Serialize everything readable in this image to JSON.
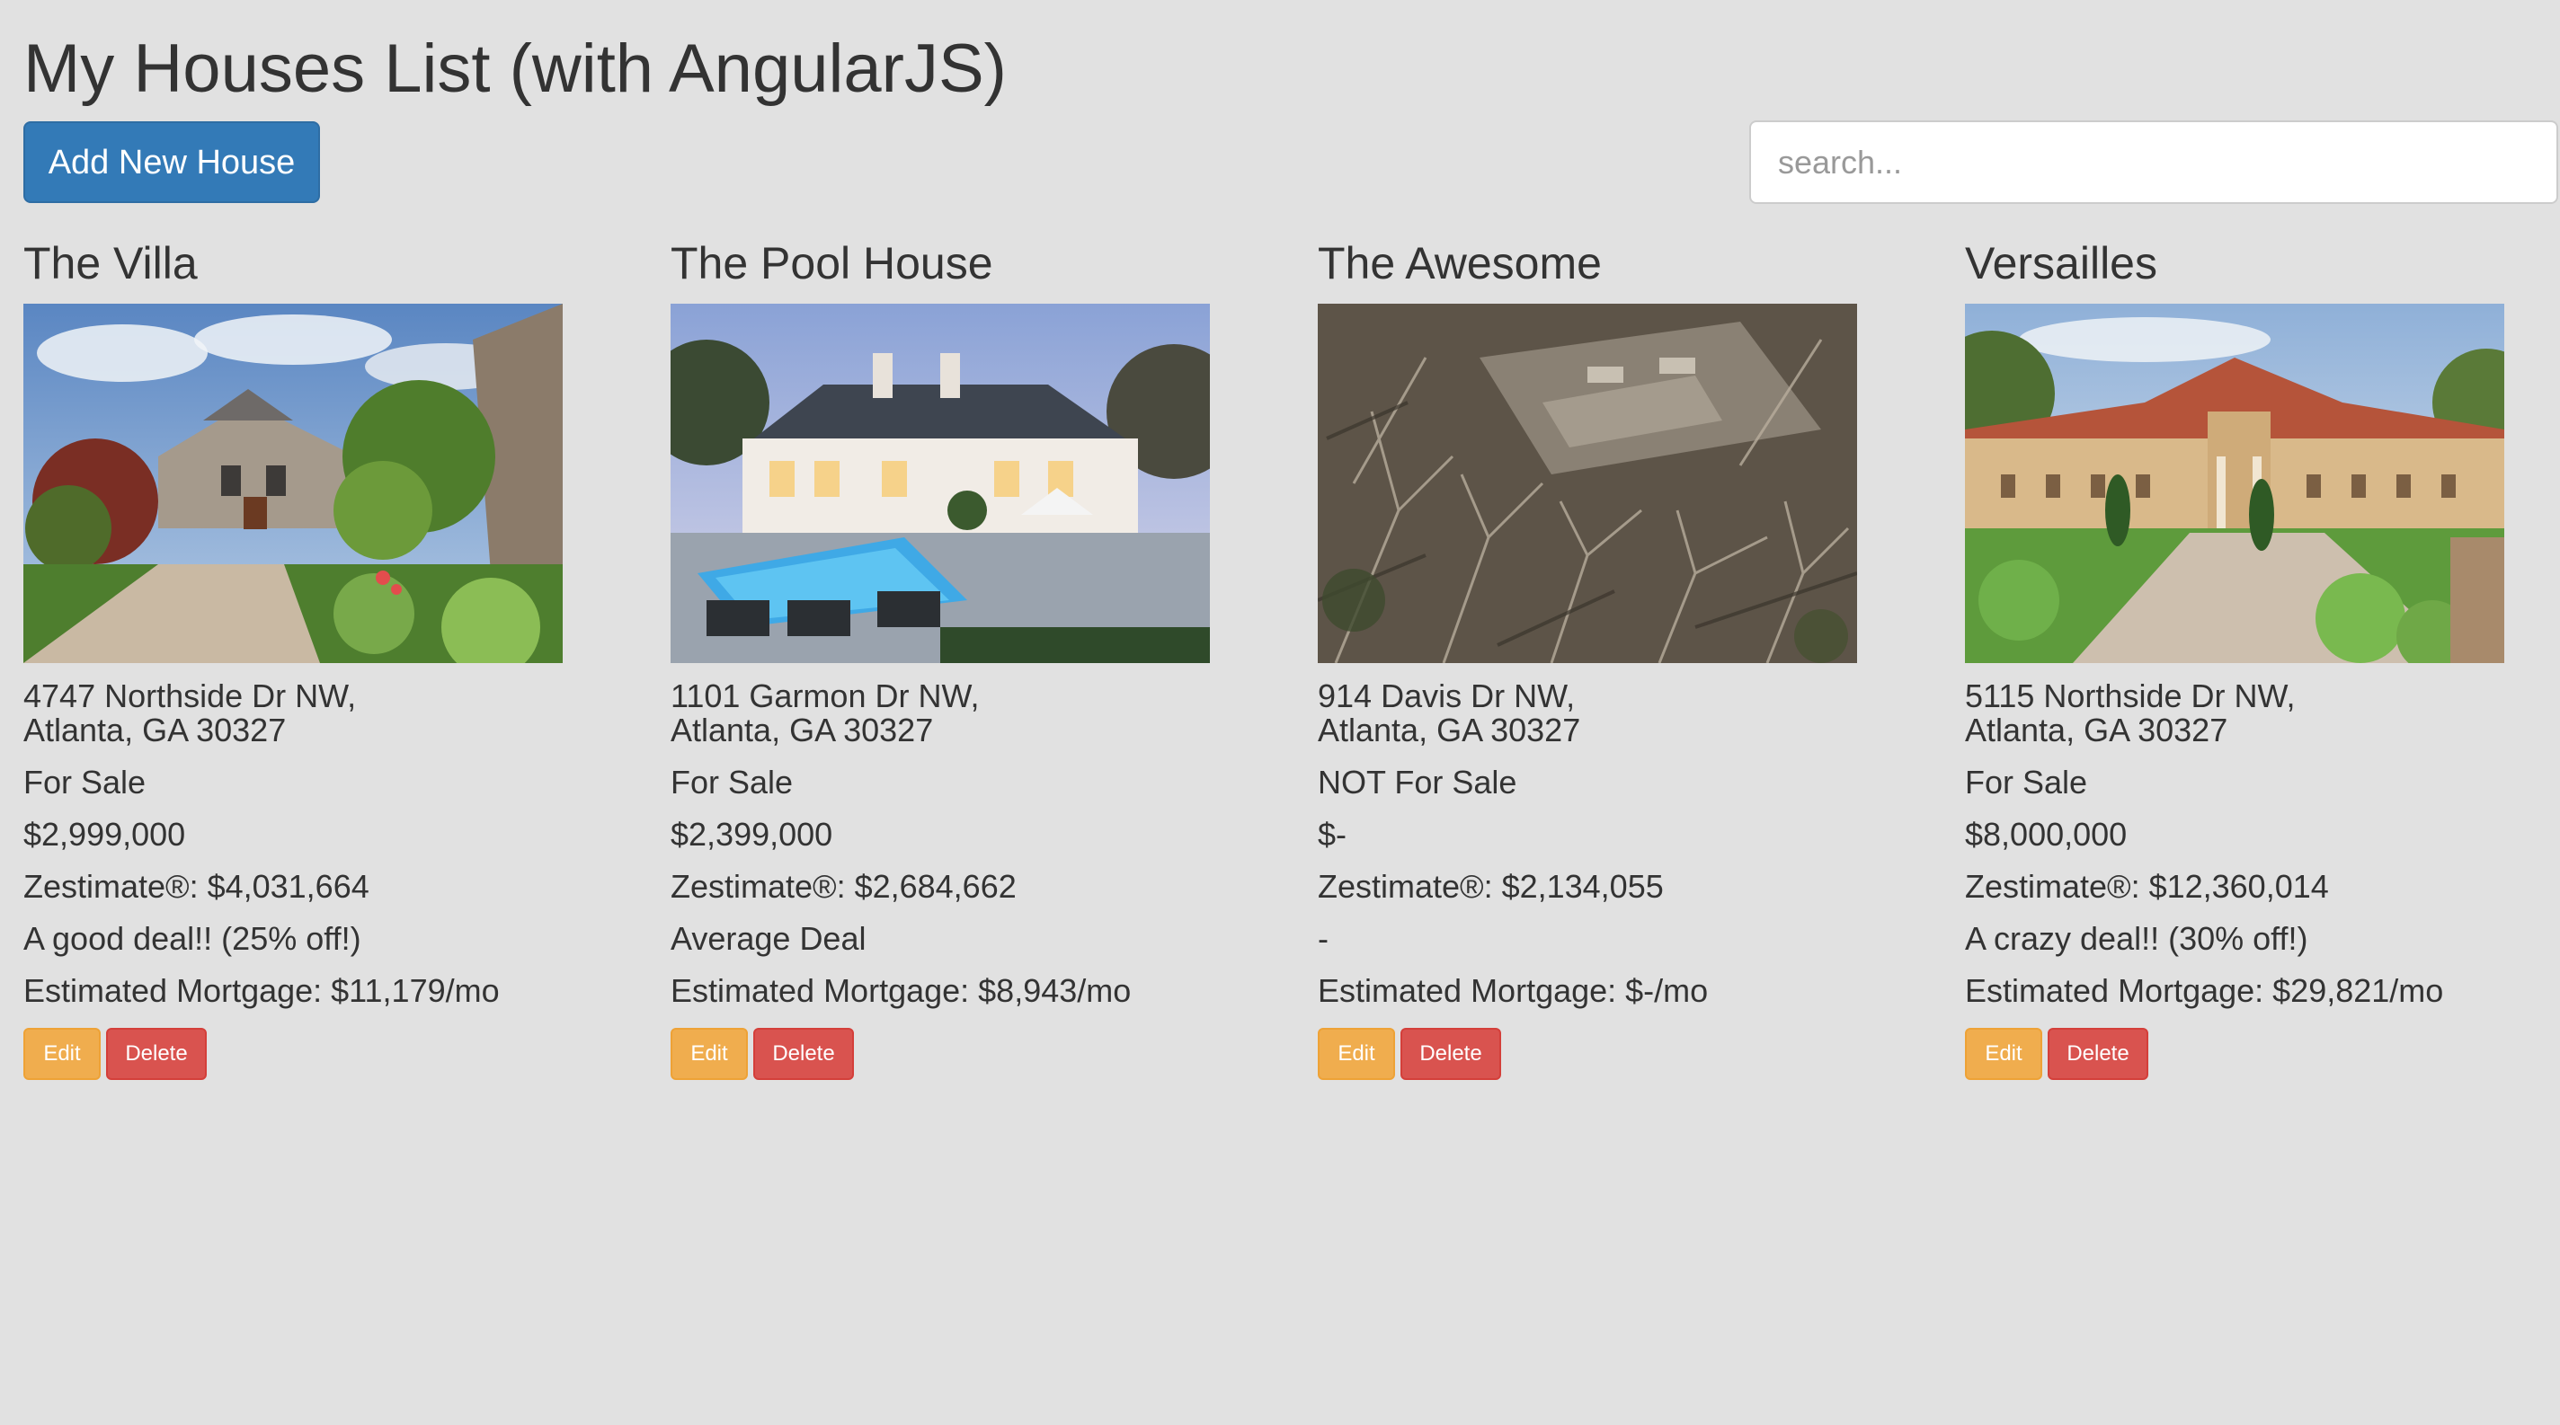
{
  "page": {
    "title": "My Houses List (with AngularJS)"
  },
  "toolbar": {
    "add_label": "Add New House",
    "search_placeholder": "search...",
    "search_value": ""
  },
  "houses": [
    {
      "name": "The Villa",
      "image": "house-photo",
      "address_line1": "4747 Northside Dr NW,",
      "address_line2": "Atlanta, GA 30327",
      "status": "For Sale",
      "price": "$2,999,000",
      "zestimate": "Zestimate®: $4,031,664",
      "deal": "A good deal!! (25% off!)",
      "mortgage": "Estimated Mortgage: $11,179/mo",
      "edit_label": "Edit",
      "delete_label": "Delete"
    },
    {
      "name": "The Pool House",
      "image": "house-photo",
      "address_line1": "1101 Garmon Dr NW,",
      "address_line2": "Atlanta, GA 30327",
      "status": "For Sale",
      "price": "$2,399,000",
      "zestimate": "Zestimate®: $2,684,662",
      "deal": "Average Deal",
      "mortgage": "Estimated Mortgage: $8,943/mo",
      "edit_label": "Edit",
      "delete_label": "Delete"
    },
    {
      "name": "The Awesome",
      "image": "house-photo",
      "address_line1": "914 Davis Dr NW,",
      "address_line2": "Atlanta, GA 30327",
      "status": "NOT For Sale",
      "price": "$-",
      "zestimate": "Zestimate®: $2,134,055",
      "deal": "-",
      "mortgage": "Estimated Mortgage: $-/mo",
      "edit_label": "Edit",
      "delete_label": "Delete"
    },
    {
      "name": "Versailles",
      "image": "house-photo",
      "address_line1": "5115 Northside Dr NW,",
      "address_line2": "Atlanta, GA 30327",
      "status": "For Sale",
      "price": "$8,000,000",
      "zestimate": "Zestimate®: $12,360,014",
      "deal": "A crazy deal!! (30% off!)",
      "mortgage": "Estimated Mortgage: $29,821/mo",
      "edit_label": "Edit",
      "delete_label": "Delete"
    }
  ],
  "colors": {
    "background": "#e1e1e1",
    "text": "#333333",
    "primary": "#337ab7",
    "warning": "#f0ad4e",
    "danger": "#d9534f"
  }
}
